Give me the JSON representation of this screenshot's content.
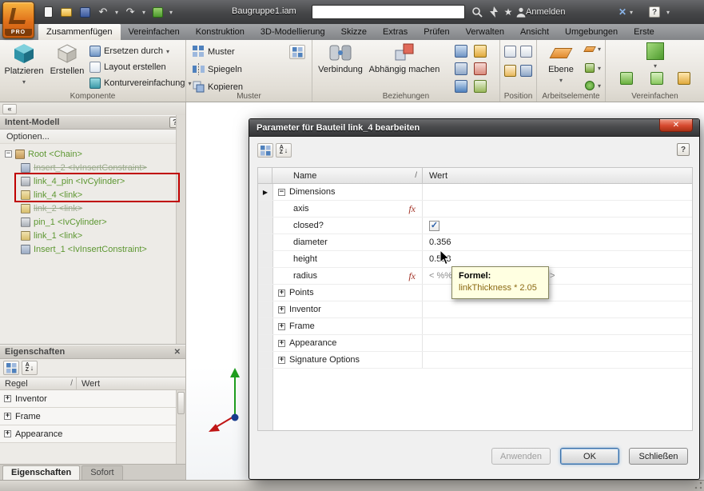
{
  "titlebar": {
    "app_badge": "PRO",
    "document_title": "Baugruppe1.iam",
    "signin_label": "Anmelden"
  },
  "ribbon": {
    "tabs": [
      {
        "label": "Zusammenfügen"
      },
      {
        "label": "Vereinfachen"
      },
      {
        "label": "Konstruktion"
      },
      {
        "label": "3D-Modellierung"
      },
      {
        "label": "Skizze"
      },
      {
        "label": "Extras"
      },
      {
        "label": "Prüfen"
      },
      {
        "label": "Verwalten"
      },
      {
        "label": "Ansicht"
      },
      {
        "label": "Umgebungen"
      },
      {
        "label": "Erste"
      }
    ],
    "komponente": {
      "label": "Komponente",
      "platzieren": "Platzieren",
      "erstellen": "Erstellen",
      "ersetzen": "Ersetzen durch",
      "layout": "Layout erstellen",
      "kontur": "Konturvereinfachung"
    },
    "muster": {
      "label": "Muster",
      "muster": "Muster",
      "spiegeln": "Spiegeln",
      "kopieren": "Kopieren"
    },
    "beziehungen": {
      "label": "Beziehungen",
      "verbindung": "Verbindung",
      "abhaengig": "Abhängig machen"
    },
    "position": {
      "label": "Position"
    },
    "arbeitselemente": {
      "label": "Arbeitselemente",
      "ebene": "Ebene"
    },
    "vereinfachen": {
      "label": "Vereinfachen"
    }
  },
  "intent_panel": {
    "title": "Intent-Modell",
    "options": "Optionen...",
    "tree": [
      {
        "label": "Root <Chain>"
      },
      {
        "label": "Insert_2 <IvInsertConstraint>"
      },
      {
        "label": "link_4_pin <IvCylinder>"
      },
      {
        "label": "link_4 <link>"
      },
      {
        "label": "link_2 <link>"
      },
      {
        "label": "pin_1 <IvCylinder>"
      },
      {
        "label": "link_1 <link>"
      },
      {
        "label": "Insert_1 <IvInsertConstraint>"
      }
    ]
  },
  "properties_panel": {
    "title": "Eigenschaften",
    "col_regel": "Regel",
    "col_wert": "Wert",
    "rows": [
      {
        "label": "Inventor"
      },
      {
        "label": "Frame"
      },
      {
        "label": "Appearance"
      }
    ],
    "tab_eigenschaften": "Eigenschaften",
    "tab_sofort": "Sofort"
  },
  "dialog": {
    "title": "Parameter für Bauteil link_4 bearbeiten",
    "col_name": "Name",
    "col_wert": "Wert",
    "rows": [
      {
        "label": "Dimensions"
      },
      {
        "label": "axis",
        "value": ""
      },
      {
        "label": "closed?",
        "checked": true
      },
      {
        "label": "diameter",
        "value": "0.356"
      },
      {
        "label": "height",
        "value": "0.513"
      },
      {
        "label": "radius",
        "value": "< %%category(\"Group Rules\") >"
      },
      {
        "label": "Points"
      },
      {
        "label": "Inventor"
      },
      {
        "label": "Frame"
      },
      {
        "label": "Appearance"
      },
      {
        "label": "Signature Options"
      }
    ],
    "tooltip_title": "Formel:",
    "tooltip_body": "linkThickness * 2.05",
    "btn_anwenden": "Anwenden",
    "btn_ok": "OK",
    "btn_schliessen": "Schließen"
  },
  "icons": {
    "dropdown": "▾",
    "help": "?",
    "close": "✕",
    "star": "★",
    "undo": "↶",
    "redo": "↷",
    "check": "✓",
    "plus": "+",
    "minus": "−",
    "row_arrow": "▶",
    "sort_asc": "/",
    "fx": "fx",
    "collapse_left": "«"
  },
  "colors": {
    "accent_orange": "#e0701a",
    "tree_green": "#5d9732",
    "highlight_red": "#c00000",
    "tooltip_bg": "#ffffe1",
    "check_blue": "#2b5fa8"
  }
}
